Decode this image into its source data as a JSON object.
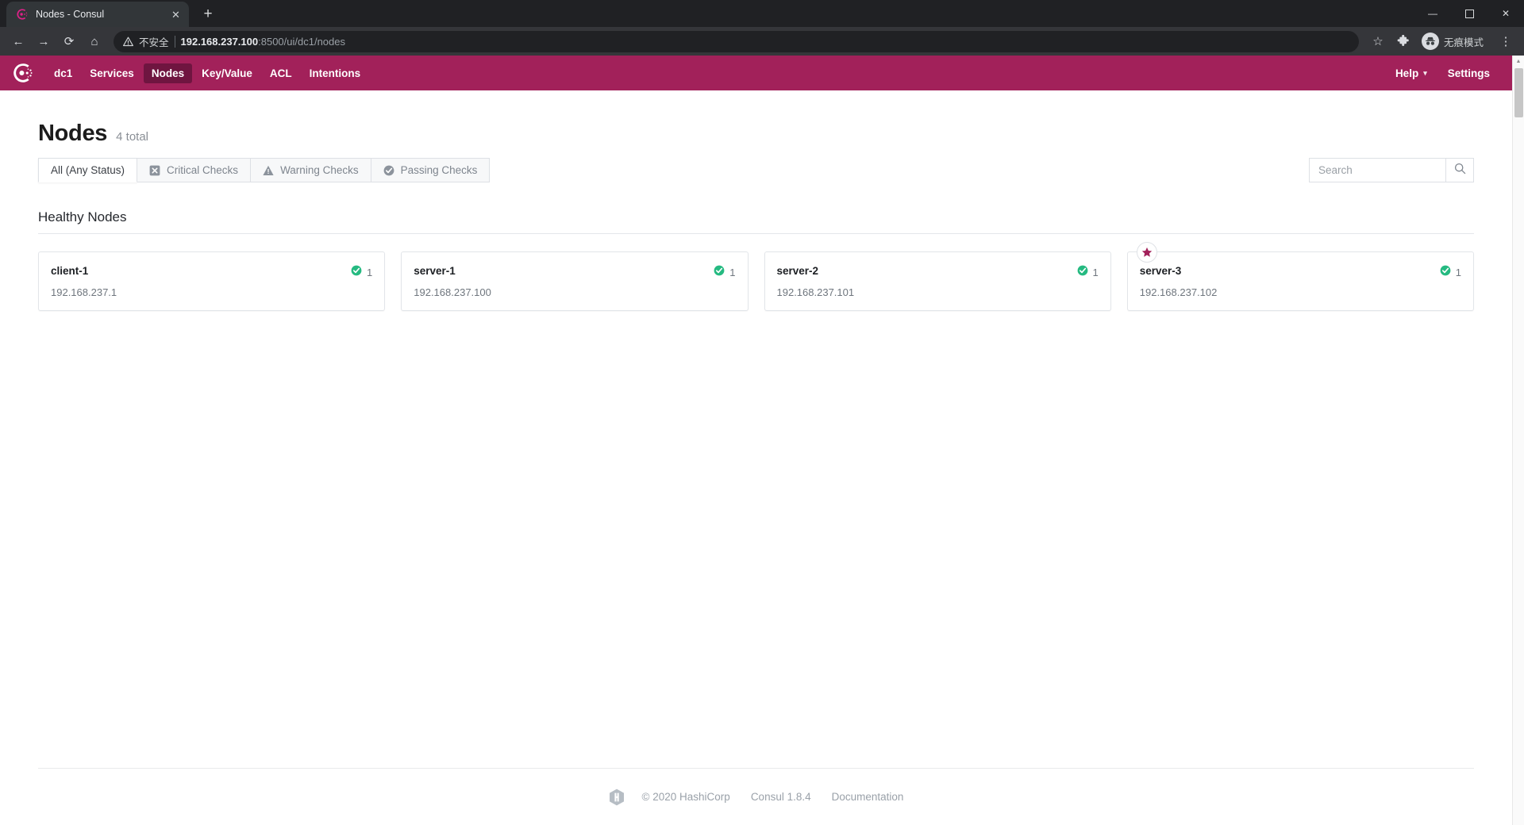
{
  "browser": {
    "tab": {
      "title": "Nodes - Consul",
      "favicon": "consul-favicon",
      "close": "✕"
    },
    "newtab_label": "+",
    "window_controls": {
      "minimize": "—",
      "maximize": "❐",
      "close": "✕"
    },
    "toolbar": {
      "back": "←",
      "forward": "→",
      "reload": "⟳",
      "home": "⌂",
      "security_warning": "不安全",
      "url_host": "192.168.237.100",
      "url_rest": ":8500/ui/dc1/nodes",
      "bookmark": "☆",
      "extensions": "extensions-puzzle-icon",
      "incognito_label": "无痕模式",
      "menu": "⋮"
    },
    "scrollbar": {
      "up": "▲",
      "down": "▼"
    }
  },
  "consul_nav": {
    "logo": "consul-logo",
    "items": [
      {
        "label": "dc1",
        "active": false
      },
      {
        "label": "Services",
        "active": false
      },
      {
        "label": "Nodes",
        "active": true
      },
      {
        "label": "Key/Value",
        "active": false
      },
      {
        "label": "ACL",
        "active": false
      },
      {
        "label": "Intentions",
        "active": false
      }
    ],
    "right": [
      {
        "label": "Help",
        "caret": "▾"
      },
      {
        "label": "Settings",
        "caret": ""
      }
    ],
    "brand_color": "#a2215a",
    "active_color": "#6f1540"
  },
  "main": {
    "title": "Nodes",
    "total": "4 total",
    "filters": [
      {
        "label": "All (Any Status)",
        "icon": "",
        "active": true
      },
      {
        "label": "Critical Checks",
        "icon": "critical-x-icon",
        "active": false
      },
      {
        "label": "Warning Checks",
        "icon": "warning-triangle-icon",
        "active": false
      },
      {
        "label": "Passing Checks",
        "icon": "passing-check-icon",
        "active": false
      }
    ],
    "search": {
      "value": "",
      "placeholder": "Search",
      "button_icon": "search-icon"
    },
    "section_title": "Healthy Nodes",
    "nodes": [
      {
        "name": "client-1",
        "address": "192.168.237.1",
        "checks": "1",
        "status": "passing",
        "leader": false
      },
      {
        "name": "server-1",
        "address": "192.168.237.100",
        "checks": "1",
        "status": "passing",
        "leader": false
      },
      {
        "name": "server-2",
        "address": "192.168.237.101",
        "checks": "1",
        "status": "passing",
        "leader": false
      },
      {
        "name": "server-3",
        "address": "192.168.237.102",
        "checks": "1",
        "status": "passing",
        "leader": true
      }
    ],
    "status_green": "#25ba81",
    "leader_star_color": "#a2215a"
  },
  "footer": {
    "logo": "hashicorp-logo",
    "copyright": "© 2020 HashiCorp",
    "version": "Consul 1.8.4",
    "docs": "Documentation"
  }
}
